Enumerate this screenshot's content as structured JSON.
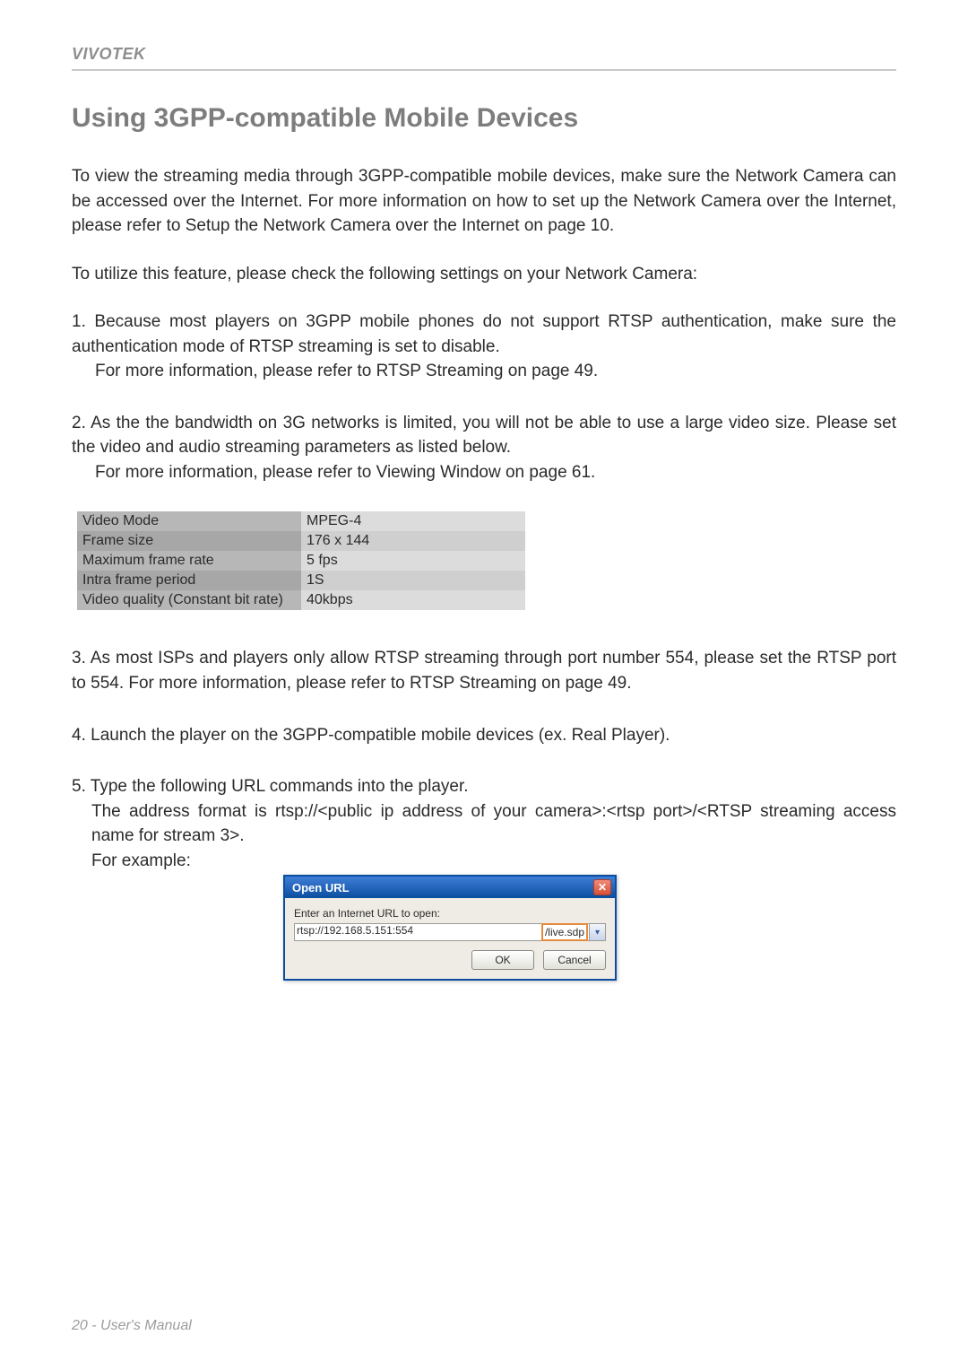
{
  "brand": "VIVOTEK",
  "section_title": "Using 3GPP-compatible Mobile Devices",
  "intro1": "To view the streaming media through 3GPP-compatible mobile devices, make sure the Network Camera can be accessed over the Internet. For more information on how to set up the Network Camera over the Internet, please refer to Setup the Network Camera over the Internet on page 10.",
  "intro2": "To utilize this feature, please check the following settings on your Network Camera:",
  "item1_line1": "1. Because most players on 3GPP mobile phones do not support RTSP authentication, make sure the authentication mode of RTSP streaming is set to disable.",
  "item1_line2": "For more information, please refer to RTSP Streaming on page 49.",
  "item2_line1": "2. As the the bandwidth on 3G networks is limited, you will not be able to use a large video size. Please set the video and audio streaming parameters as listed below.",
  "item2_line2": "For more information, please refer to Viewing Window on page 61.",
  "table_rows": [
    {
      "label": "Video Mode",
      "value": "MPEG-4"
    },
    {
      "label": "Frame size",
      "value": "176 x 144"
    },
    {
      "label": "Maximum frame rate",
      "value": "5 fps"
    },
    {
      "label": "Intra frame period",
      "value": "1S"
    },
    {
      "label": "Video quality (Constant bit rate)",
      "value": "40kbps"
    }
  ],
  "item3": "3. As most ISPs and players only allow RTSP streaming through port number 554, please set the RTSP port to 554. For more information, please refer to RTSP Streaming on page 49.",
  "item4": "4. Launch the player on the 3GPP-compatible mobile devices (ex. Real Player).",
  "item5_line1": "5. Type the following URL commands into the player.",
  "item5_line2": "The address format is rtsp://<public ip address of your camera>:<rtsp port>/<RTSP streaming access name for stream 3>.",
  "item5_line3": "For example:",
  "dialog": {
    "title": "Open URL",
    "label": "Enter an Internet URL to open:",
    "input_value_prefix": "rtsp://192.168.5.151:554",
    "input_value_highlight": "/live.sdp",
    "ok": "OK",
    "cancel": "Cancel"
  },
  "footer": "20 - User's Manual"
}
